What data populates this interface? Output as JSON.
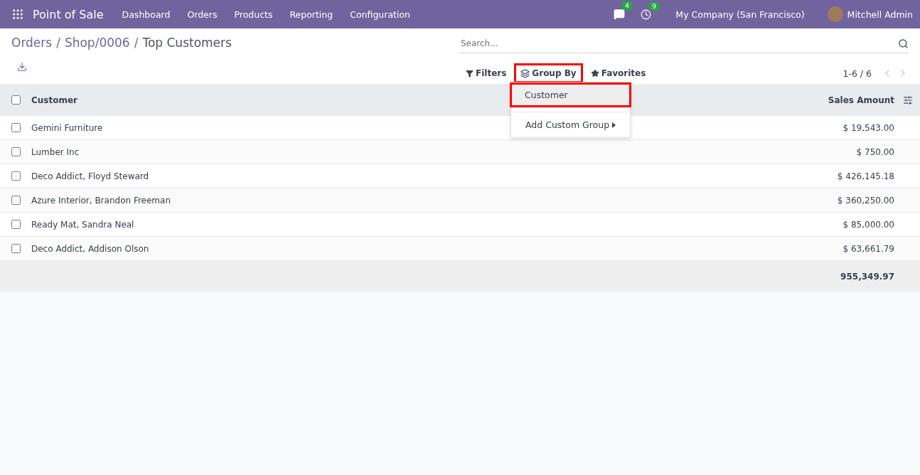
{
  "navbar": {
    "app_name": "Point of Sale",
    "menu": [
      "Dashboard",
      "Orders",
      "Products",
      "Reporting",
      "Configuration"
    ],
    "messages_badge": "4",
    "activities_badge": "9",
    "company": "My Company (San Francisco)",
    "user": "Mitchell Admin"
  },
  "breadcrumb": [
    {
      "label": "Orders"
    },
    {
      "label": "Shop/0006",
      "separator": "/"
    },
    {
      "label": "Top Customers",
      "separator": "/"
    }
  ],
  "search": {
    "placeholder": "Search..."
  },
  "filters": [
    {
      "label": "Filters",
      "kind": "filter",
      "highlighted": false
    },
    {
      "label": "Group By",
      "kind": "group",
      "highlighted": true
    },
    {
      "label": "Favorites",
      "kind": "star",
      "highlighted": false
    }
  ],
  "pager": "1-6 / 6",
  "group_menu": {
    "items": [
      {
        "label": "Customer",
        "highlighted": true
      }
    ],
    "custom": "Add Custom Group"
  },
  "table": {
    "all_selected": false,
    "columns": [
      "Customer",
      "Sales Amount"
    ],
    "rows": [
      {
        "customer": "Gemini Furniture",
        "amount": "$ 19,543.00",
        "checked": false
      },
      {
        "customer": "Lumber Inc",
        "amount": "$ 750.00",
        "checked": false
      },
      {
        "customer": "Deco Addict, Floyd Steward",
        "amount": "$ 426,145.18",
        "checked": false
      },
      {
        "customer": "Azure Interior, Brandon Freeman",
        "amount": "$ 360,250.00",
        "checked": false
      },
      {
        "customer": "Ready Mat, Sandra Neal",
        "amount": "$ 85,000.00",
        "checked": false
      },
      {
        "customer": "Deco Addict, Addison Olson",
        "amount": "$ 63,661.79",
        "checked": false
      }
    ],
    "total": "955,349.97"
  }
}
